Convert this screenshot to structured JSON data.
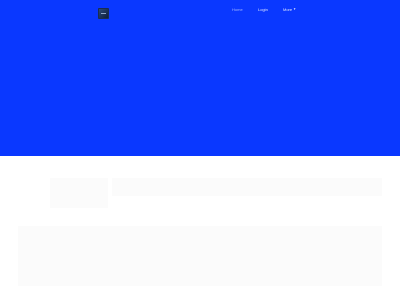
{
  "colors": {
    "hero_background": "#0a38ff",
    "page_background": "#ffffff",
    "logo_background": "#1b2d4f"
  },
  "nav": {
    "items": [
      {
        "label": "Home"
      },
      {
        "label": "Login"
      },
      {
        "label": "More"
      }
    ],
    "more_icon": "chevron-down-icon"
  },
  "logo": {
    "icon": "site-logo-icon"
  }
}
